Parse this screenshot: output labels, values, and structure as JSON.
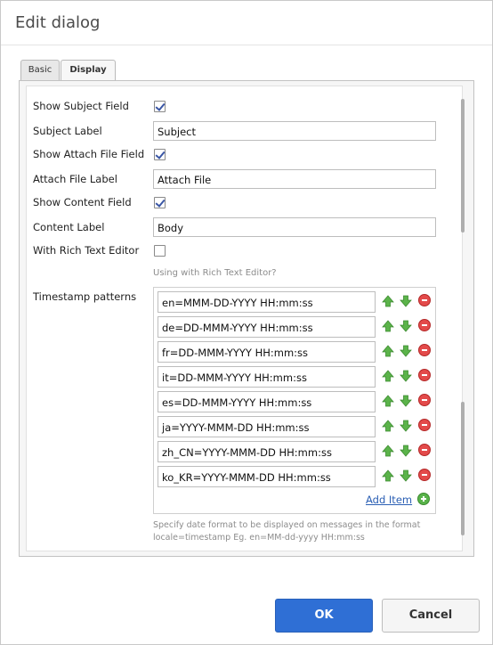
{
  "dialog": {
    "title": "Edit dialog"
  },
  "tabs": [
    {
      "label": "Basic",
      "active": false
    },
    {
      "label": "Display",
      "active": true
    }
  ],
  "form": {
    "show_subject_label": "Show Subject Field",
    "show_subject_checked": true,
    "subject_label_label": "Subject Label",
    "subject_label_value": "Subject",
    "show_attach_label": "Show Attach File Field",
    "show_attach_checked": true,
    "attach_label_label": "Attach File Label",
    "attach_label_value": "Attach File",
    "show_content_label": "Show Content Field",
    "show_content_checked": true,
    "content_label_label": "Content Label",
    "content_label_value": "Body",
    "rich_text_label": "With Rich Text Editor",
    "rich_text_checked": false,
    "rich_text_hint": "Using with Rich Text Editor?",
    "timestamp_label": "Timestamp patterns",
    "timestamp_patterns": [
      "en=MMM-DD-YYYY HH:mm:ss",
      "de=DD-MMM-YYYY HH:mm:ss",
      "fr=DD-MMM-YYYY HH:mm:ss",
      "it=DD-MMM-YYYY HH:mm:ss",
      "es=DD-MMM-YYYY HH:mm:ss",
      "ja=YYYY-MMM-DD HH:mm:ss",
      "zh_CN=YYYY-MMM-DD HH:mm:ss",
      "ko_KR=YYYY-MMM-DD HH:mm:ss"
    ],
    "add_item_label": "Add Item",
    "timestamp_desc": "Specify date format to be displayed on messages in the format locale=timestamp Eg. en=MM-dd-yyyy HH:mm:ss"
  },
  "footer": {
    "ok_label": "OK",
    "cancel_label": "Cancel"
  },
  "colors": {
    "primary_button": "#2f6fd5",
    "remove_icon": "#e34a4a",
    "move_arrow": "#5bb34a",
    "add_icon": "#59b34a",
    "link": "#2b5fb4"
  }
}
